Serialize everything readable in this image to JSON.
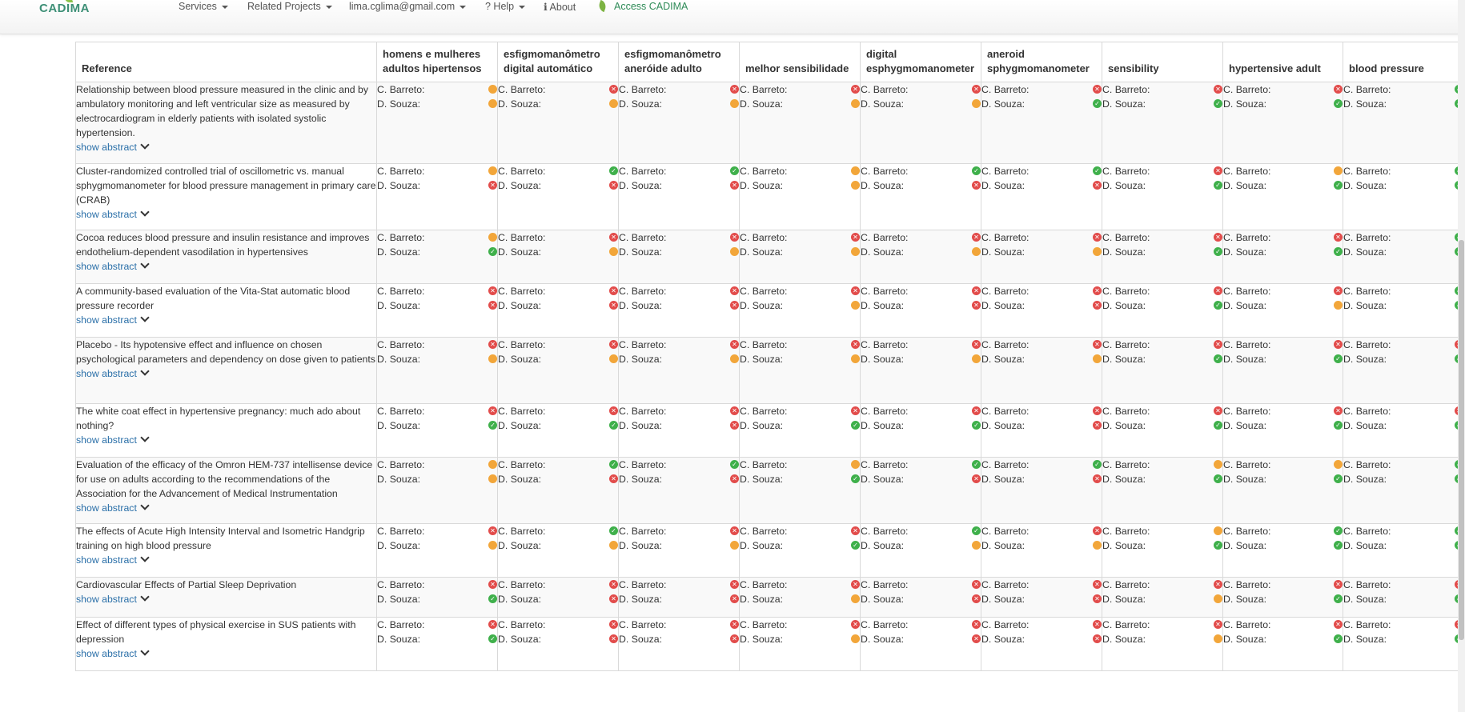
{
  "nav": {
    "logo": "CADIMA",
    "services": "Services",
    "related_projects": "Related Projects",
    "user": "lima.cglima@gmail.com",
    "help": "? Help",
    "about": "ℹ About",
    "access": "Access CADIMA"
  },
  "colors": {
    "ok": "#3fb04b",
    "no": "#e24c4b",
    "maybe": "#f2a63a"
  },
  "table": {
    "headers": [
      "Reference",
      "homens e mulheres adultos hipertensos",
      "esfigmomanômetro digital automático",
      "esfigmomanômetro aneróide adulto",
      "melhor sensibilidade",
      "digital esphygmomanometer",
      "aneroid sphygmomanometer",
      "sensibility",
      "hypertensive adult",
      "blood pressure"
    ],
    "show_abstract": "show abstract",
    "raters": [
      "C. Barreto:",
      "D. Souza:"
    ],
    "rows": [
      {
        "title": "Relationship between blood pressure measured in the clinic and by ambulatory monitoring and left ventricular size as measured by electrocardiogram in elderly patients with isolated systolic hypertension.",
        "ratings": [
          [
            "o",
            "o"
          ],
          [
            "r",
            "o"
          ],
          [
            "r",
            "o"
          ],
          [
            "r",
            "o"
          ],
          [
            "r",
            "o"
          ],
          [
            "r",
            "g"
          ],
          [
            "r",
            "g"
          ],
          [
            "r",
            "g"
          ],
          [
            "g",
            "g"
          ]
        ]
      },
      {
        "title": "Cluster-randomized controlled trial of oscillometric vs. manual sphygmomanometer for blood pressure management in primary care (CRAB)",
        "ratings": [
          [
            "o",
            "r"
          ],
          [
            "g",
            "r"
          ],
          [
            "g",
            "r"
          ],
          [
            "o",
            "o"
          ],
          [
            "g",
            "r"
          ],
          [
            "g",
            "r"
          ],
          [
            "r",
            "g"
          ],
          [
            "o",
            "g"
          ],
          [
            "g",
            "g"
          ]
        ]
      },
      {
        "title": "Cocoa reduces blood pressure and insulin resistance and improves endothelium-dependent vasodilation in hypertensives",
        "ratings": [
          [
            "o",
            "g"
          ],
          [
            "r",
            "o"
          ],
          [
            "r",
            "o"
          ],
          [
            "r",
            "o"
          ],
          [
            "r",
            "o"
          ],
          [
            "r",
            "o"
          ],
          [
            "r",
            "g"
          ],
          [
            "r",
            "g"
          ],
          [
            "g",
            "g"
          ]
        ]
      },
      {
        "title": "A community-based evaluation of the Vita-Stat automatic blood pressure recorder",
        "ratings": [
          [
            "r",
            "r"
          ],
          [
            "r",
            "r"
          ],
          [
            "r",
            "r"
          ],
          [
            "r",
            "o"
          ],
          [
            "r",
            "r"
          ],
          [
            "r",
            "r"
          ],
          [
            "r",
            "g"
          ],
          [
            "r",
            "o"
          ],
          [
            "g",
            "g"
          ]
        ]
      },
      {
        "title": "Placebo - Its hypotensive effect and influence on chosen psychological parameters and dependency on dose given to patients",
        "ratings": [
          [
            "r",
            "o"
          ],
          [
            "r",
            "o"
          ],
          [
            "r",
            "o"
          ],
          [
            "r",
            "o"
          ],
          [
            "r",
            "o"
          ],
          [
            "r",
            "o"
          ],
          [
            "r",
            "g"
          ],
          [
            "r",
            "g"
          ],
          [
            "r",
            "g"
          ]
        ]
      },
      {
        "title": "The white coat effect in hypertensive pregnancy: much ado about nothing?",
        "ratings": [
          [
            "r",
            "g"
          ],
          [
            "r",
            "g"
          ],
          [
            "r",
            "r"
          ],
          [
            "r",
            "g"
          ],
          [
            "r",
            "g"
          ],
          [
            "r",
            "r"
          ],
          [
            "r",
            "g"
          ],
          [
            "r",
            "g"
          ],
          [
            "r",
            "g"
          ]
        ]
      },
      {
        "title": "Evaluation of the efficacy of the Omron HEM-737 intellisense device for use on adults according to the recommendations of the Association for the Advancement of Medical Instrumentation",
        "ratings": [
          [
            "o",
            "o"
          ],
          [
            "g",
            "r"
          ],
          [
            "g",
            "r"
          ],
          [
            "o",
            "g"
          ],
          [
            "g",
            "r"
          ],
          [
            "g",
            "r"
          ],
          [
            "o",
            "g"
          ],
          [
            "o",
            "g"
          ],
          [
            "g",
            "g"
          ]
        ]
      },
      {
        "title": "The effects of Acute High Intensity Interval and Isometric Handgrip training on high blood pressure",
        "ratings": [
          [
            "r",
            "o"
          ],
          [
            "g",
            "o"
          ],
          [
            "r",
            "o"
          ],
          [
            "r",
            "g"
          ],
          [
            "g",
            "o"
          ],
          [
            "r",
            "o"
          ],
          [
            "o",
            "g"
          ],
          [
            "g",
            "g"
          ],
          [
            "g",
            "g"
          ]
        ]
      },
      {
        "title": "Cardiovascular Effects of Partial Sleep Deprivation",
        "ratings": [
          [
            "r",
            "g"
          ],
          [
            "r",
            "r"
          ],
          [
            "r",
            "r"
          ],
          [
            "r",
            "o"
          ],
          [
            "r",
            "r"
          ],
          [
            "r",
            "r"
          ],
          [
            "r",
            "o"
          ],
          [
            "r",
            "g"
          ],
          [
            "r",
            "g"
          ]
        ]
      },
      {
        "title": "Effect of different types of physical exercise in SUS patients with depression",
        "ratings": [
          [
            "r",
            "g"
          ],
          [
            "r",
            "r"
          ],
          [
            "r",
            "r"
          ],
          [
            "r",
            "o"
          ],
          [
            "r",
            "r"
          ],
          [
            "r",
            "r"
          ],
          [
            "r",
            "o"
          ],
          [
            "r",
            "g"
          ],
          [
            "r",
            "g"
          ]
        ]
      }
    ]
  }
}
